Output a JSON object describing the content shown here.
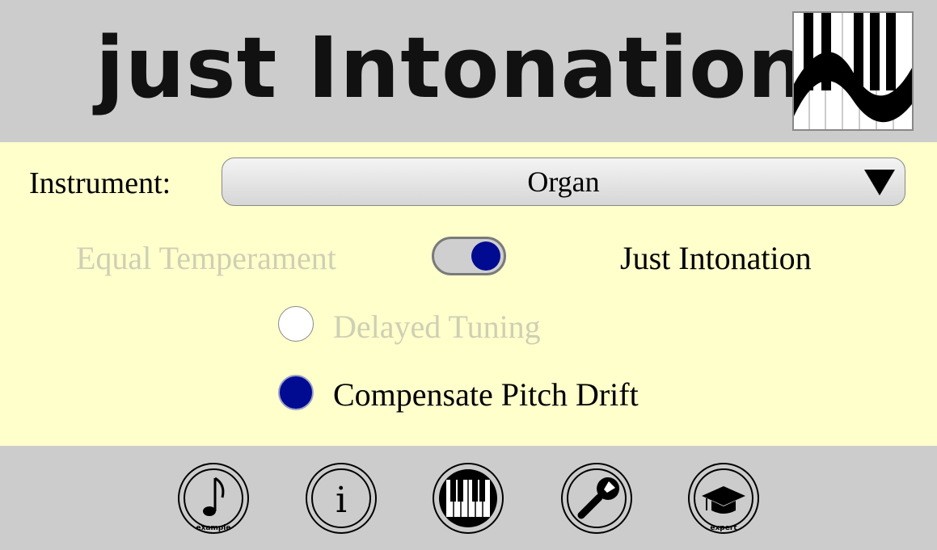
{
  "header": {
    "title": "just Intonation",
    "logo_icon": "piano-wave-logo"
  },
  "instrument": {
    "label": "Instrument:",
    "selected": "Organ"
  },
  "tuning": {
    "left_label": "Equal Temperament",
    "right_label": "Just Intonation",
    "toggle_on": true
  },
  "options": [
    {
      "label": "Delayed Tuning",
      "selected": false
    },
    {
      "label": "Compensate Pitch Drift",
      "selected": true
    }
  ],
  "nav": [
    {
      "icon": "music-note-icon",
      "caption": "example"
    },
    {
      "icon": "info-icon",
      "caption": ""
    },
    {
      "icon": "piano-keys-icon",
      "caption": ""
    },
    {
      "icon": "wrench-icon",
      "caption": ""
    },
    {
      "icon": "graduation-cap-icon",
      "caption": "expert"
    }
  ],
  "colors": {
    "accent": "#000b91",
    "panel": "#ffffcc",
    "chrome": "#cccccc",
    "disabled_text": "#cfcfb4"
  }
}
